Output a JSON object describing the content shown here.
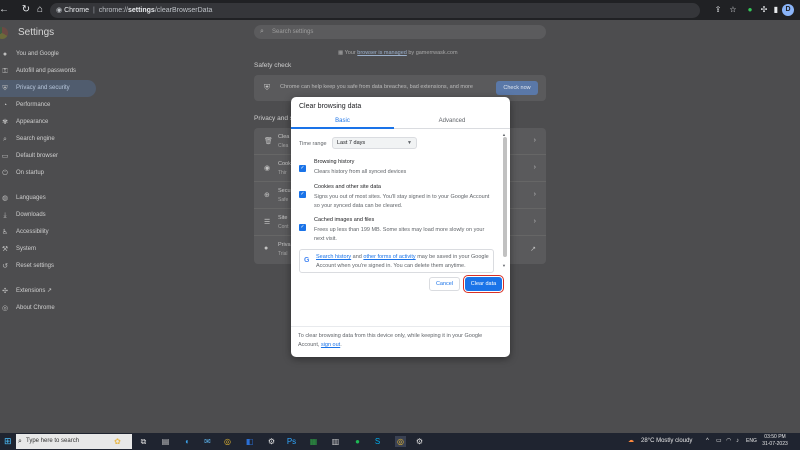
{
  "browser": {
    "site_label": "Chrome",
    "url_prefix": "chrome://",
    "url_bold": "settings",
    "url_suffix": "/clearBrowserData",
    "profile_initial": "D"
  },
  "settings": {
    "title": "Settings",
    "search_placeholder": "Search settings",
    "managed_prefix": "Your ",
    "managed_link": "browser is managed",
    "managed_suffix": " by gamerrwask.com",
    "sidebar": [
      "You and Google",
      "Autofill and passwords",
      "Privacy and security",
      "Performance",
      "Appearance",
      "Search engine",
      "Default browser",
      "On startup",
      "Languages",
      "Downloads",
      "Accessibility",
      "System",
      "Reset settings",
      "Extensions",
      "About Chrome"
    ],
    "safety_check_title": "Safety check",
    "safety_text": "Chrome can help keep you safe from data breaches, bad extensions, and more",
    "check_now": "Check now",
    "privacy_title": "Privacy and s",
    "privacy_rows": [
      {
        "label": "Clea",
        "sub": "Clea"
      },
      {
        "label": "Cook",
        "sub": "Thir"
      },
      {
        "label": "Secu",
        "sub": "Safe"
      },
      {
        "label": "Site",
        "sub": "Cont"
      },
      {
        "label": "Priva",
        "sub": "Trial"
      }
    ]
  },
  "dialog": {
    "title": "Clear browsing data",
    "tabs": [
      "Basic",
      "Advanced"
    ],
    "time_range_label": "Time range",
    "time_range_value": "Last 7 days",
    "options": [
      {
        "title": "Browsing history",
        "desc": "Clears history from all synced devices",
        "checked": true
      },
      {
        "title": "Cookies and other site data",
        "desc": "Signs you out of most sites. You'll stay signed in to your Google Account so your synced data can be cleared.",
        "checked": true
      },
      {
        "title": "Cached images and files",
        "desc": "Frees up less than 199 MB. Some sites may load more slowly on your next visit.",
        "checked": true
      }
    ],
    "google_link1": "Search history",
    "google_mid": " and ",
    "google_link2": "other forms of activity",
    "google_rest": " may be saved in your Google Account when you're signed in. You can delete them anytime.",
    "cancel": "Cancel",
    "clear": "Clear data",
    "footer_prefix": "To clear browsing data from this device only, while keeping it in your Google Account, ",
    "footer_link": "sign out",
    "footer_suffix": "."
  },
  "taskbar": {
    "search_placeholder": "Type here to search",
    "weather": "28°C  Mostly cloudy",
    "lang": "ENG",
    "time": "03:50 PM",
    "date": "31-07-2023"
  },
  "colors": {
    "accent": "#1a73e8",
    "highlight_outline": "#d93025"
  }
}
